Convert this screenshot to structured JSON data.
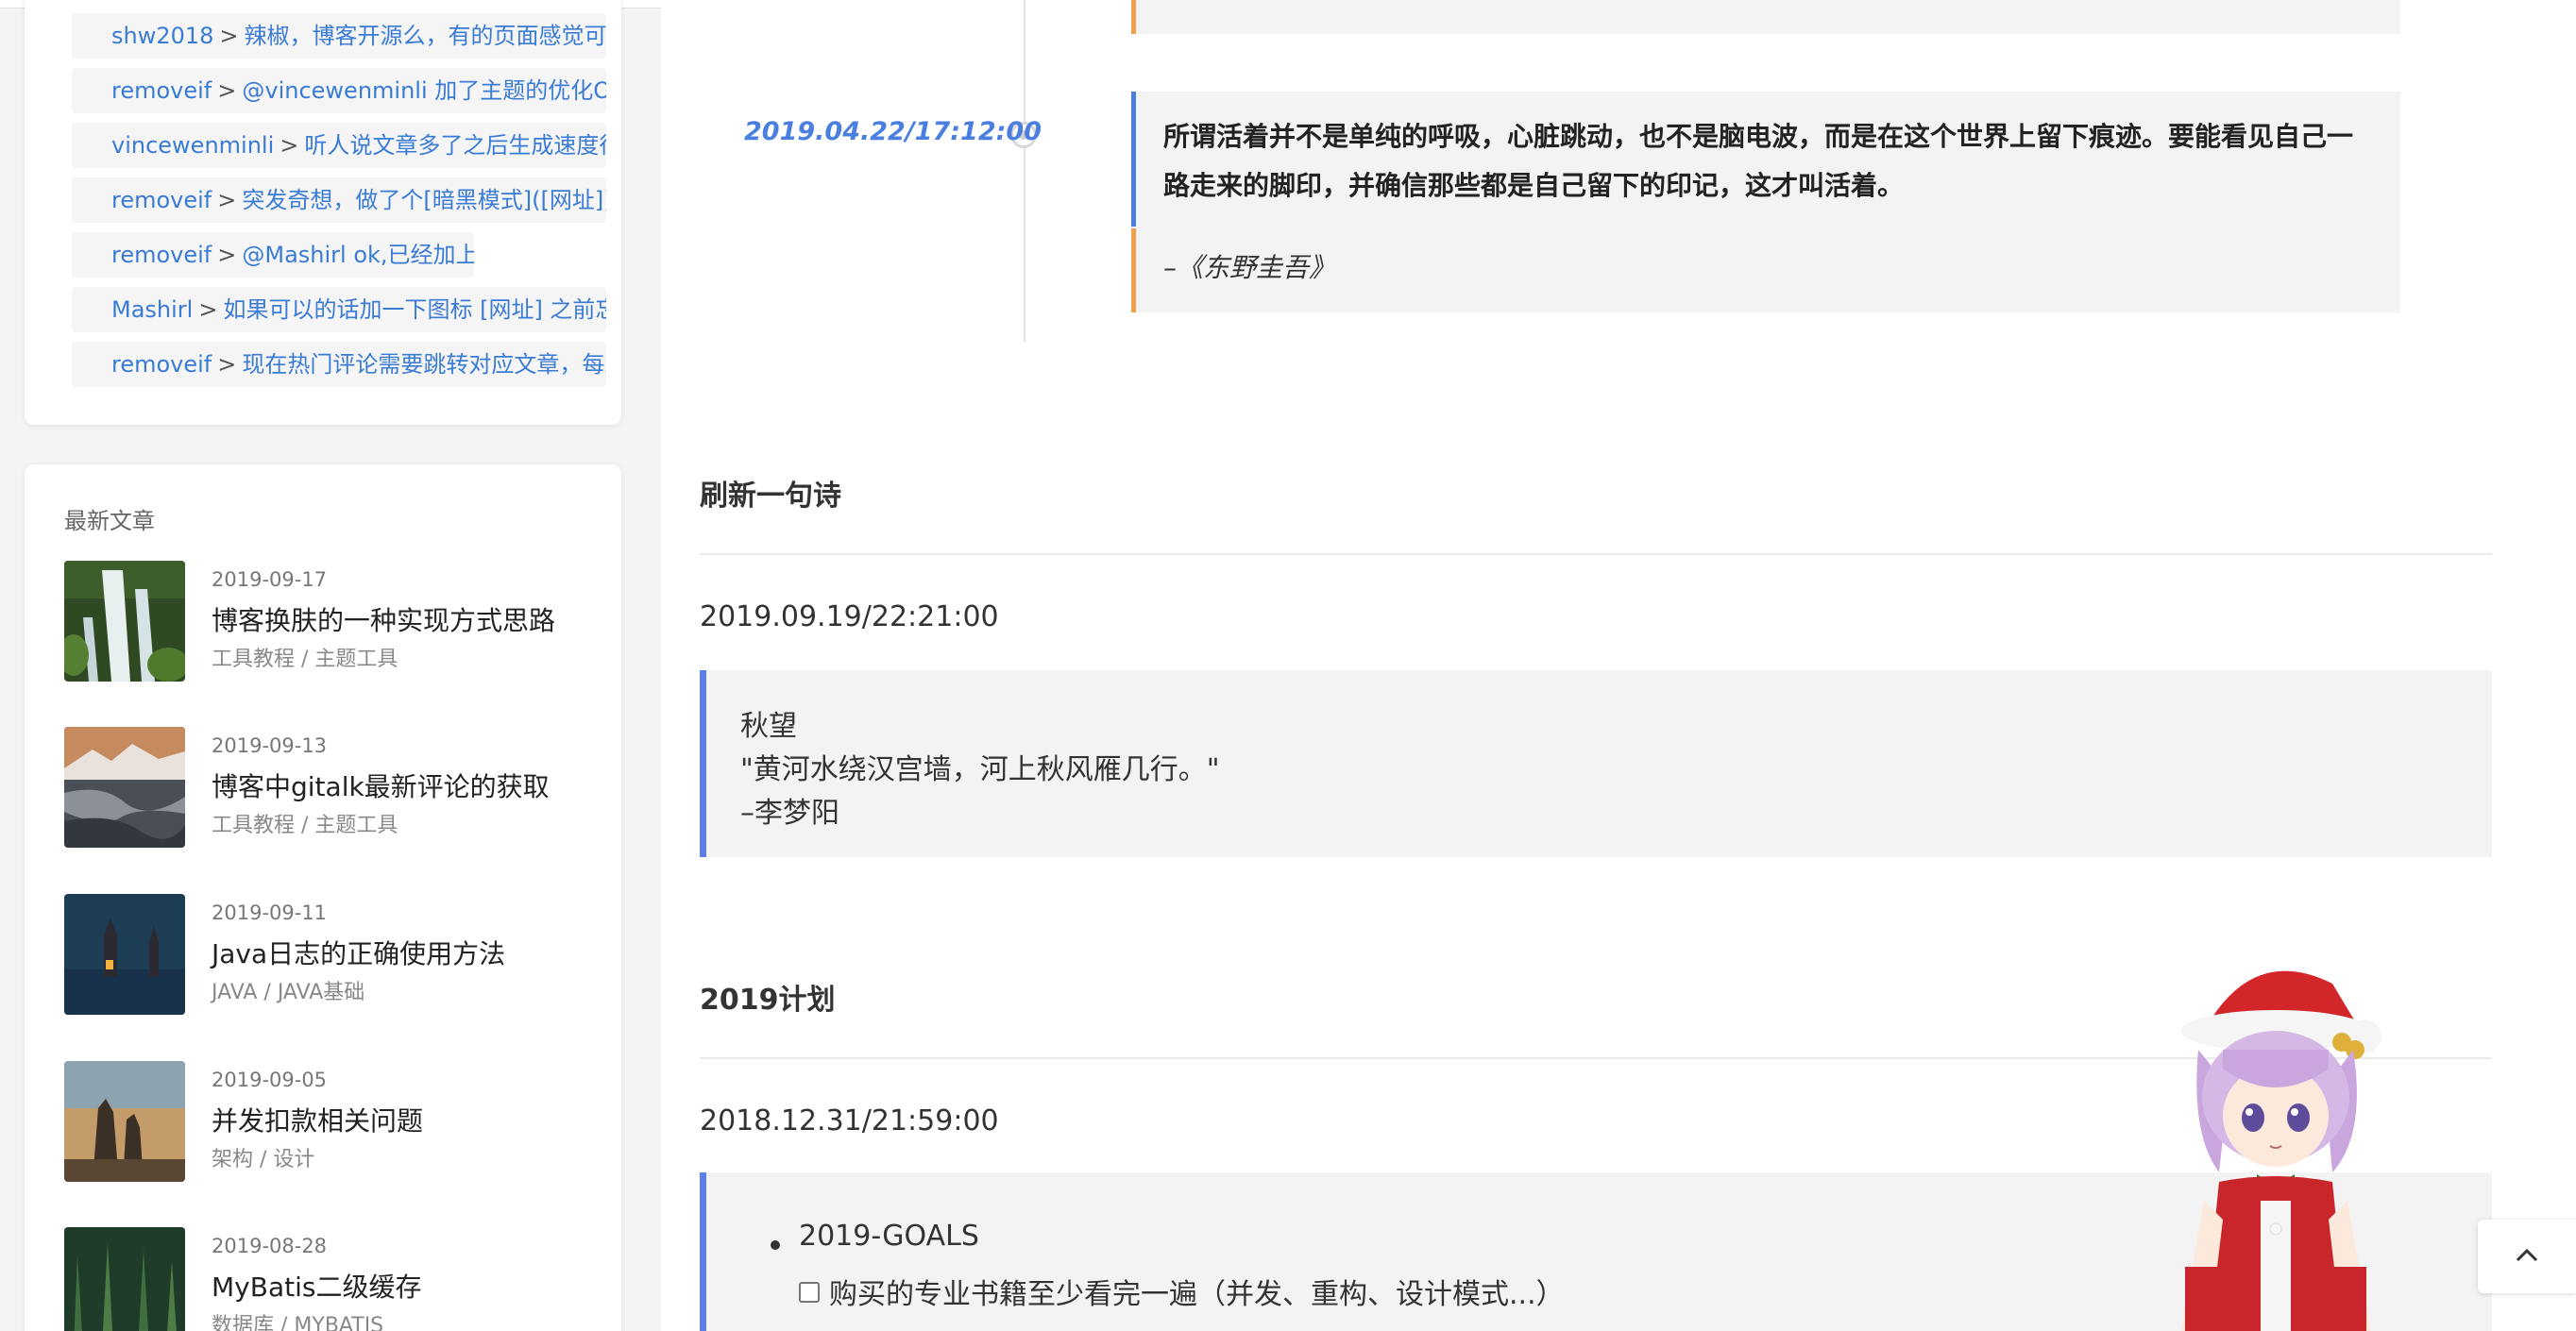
{
  "sidebar": {
    "comments": [
      {
        "user": "shw2018",
        "sep": ">",
        "text": "辣椒，博客开源么，有的页面感觉可以"
      },
      {
        "user": "removeif",
        "sep": ">",
        "text": "@vincewenminli 加了主题的优化OOM"
      },
      {
        "user": "vincewenminli",
        "sep": ">",
        "text": "听人说文章多了之后生成速度很慢"
      },
      {
        "user": "removeif",
        "sep": ">",
        "text": "突发奇想，做了个[暗黑模式]([网址])的"
      },
      {
        "user": "removeif",
        "sep": ">",
        "text": "@Mashirl ok,已经加上了哈"
      },
      {
        "user": "Mashirl",
        "sep": ">",
        "text": "如果可以的话加一下图标 [网址] 之前忘"
      },
      {
        "user": "removeif",
        "sep": ">",
        "text": "现在热门评论需要跳转对应文章，每次"
      }
    ],
    "recent_title": "最新文章",
    "posts": [
      {
        "date": "2019-09-17",
        "title": "博客换肤的一种实现方式思路",
        "tags": "工具教程 / 主题工具"
      },
      {
        "date": "2019-09-13",
        "title": "博客中gitalk最新评论的获取",
        "tags": "工具教程 / 主题工具"
      },
      {
        "date": "2019-09-11",
        "title": "Java日志的正确使用方法",
        "tags": "JAVA / JAVA基础"
      },
      {
        "date": "2019-09-05",
        "title": "并发扣款相关问题",
        "tags": "架构 / 设计"
      },
      {
        "date": "2019-08-28",
        "title": "MyBatis二级缓存",
        "tags": "数据库 / MYBATIS"
      }
    ]
  },
  "main": {
    "timeline_date": "2019.04.22/17:12:00",
    "quote_text": "所谓活着并不是单纯的呼吸，心脏跳动，也不是脑电波，而是在这个世界上留下痕迹。要能看见自己一路走来的脚印，并确信那些都是自己留下的印记，这才叫活着。",
    "quote_author": "–《东野圭吾》",
    "section1_title": "刷新一句诗",
    "section1_time": "2019.09.19/22:21:00",
    "poem": {
      "title": "秋望",
      "line": "\"黄河水绕汉宫墙，河上秋风雁几行。\"",
      "author": "–李梦阳"
    },
    "section2_title": "2019计划",
    "section2_time": "2018.12.31/21:59:00",
    "plan": {
      "goal": "2019-GOALS",
      "task": "购买的专业书籍至少看完一遍（并发、重构、设计模式...）"
    }
  },
  "colors": {
    "link": "#3a7bd5",
    "accent_blue": "#4a7fe0",
    "accent_orange": "#f0a04b"
  }
}
